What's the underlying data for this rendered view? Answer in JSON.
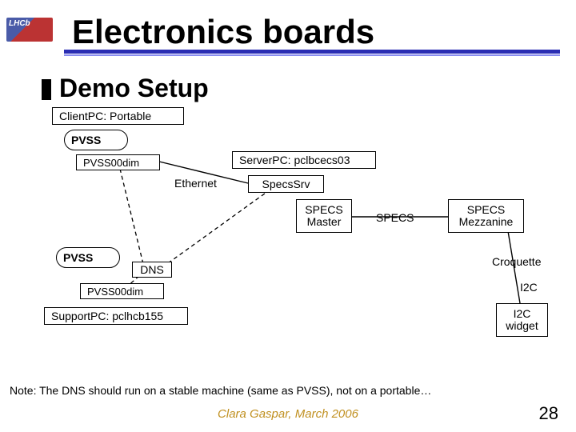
{
  "header": {
    "logo_text": "LHCb",
    "title": "Electronics boards"
  },
  "subtitle": "Demo Setup",
  "diagram": {
    "client_pc": "ClientPC: Portable",
    "pvss_top": "PVSS",
    "pvss00dim_top": "PVSS00dim",
    "ethernet": "Ethernet",
    "server_pc": "ServerPC: pclbcecs03",
    "specssrv": "SpecsSrv",
    "specs_master": "SPECS\nMaster",
    "specs_bus": "SPECS",
    "specs_mezz": "SPECS\nMezzanine",
    "pvss_bot": "PVSS",
    "dns": "DNS",
    "pvss00dim_bot": "PVSS00dim",
    "support_pc": "SupportPC: pclhcb155",
    "croquette": "Croquette",
    "i2c": "I2C",
    "i2c_widget": "I2C\nwidget"
  },
  "note": "Note: The DNS should run on a stable machine (same as PVSS), not on a portable…",
  "footer": {
    "author_date": "Clara Gaspar, March 2006",
    "page": "28"
  }
}
